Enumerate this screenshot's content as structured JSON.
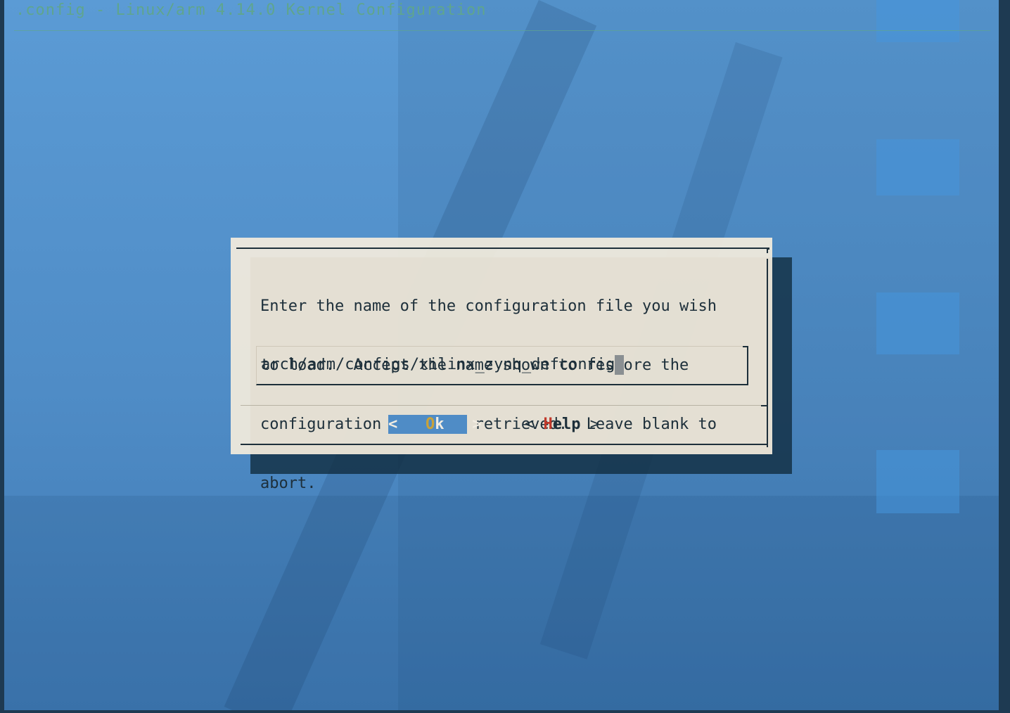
{
  "window": {
    "title": ".config - Linux/arm 4.14.0 Kernel Configuration"
  },
  "dialog": {
    "prompt_lines": [
      "Enter the name of the configuration file you wish",
      "to load.  Accept the name shown to restore the",
      "configuration you last retrieved.  Leave blank to",
      "abort."
    ],
    "input_value": "arch/arm/configs/xilinx_zynq_defconfig",
    "buttons": {
      "ok": {
        "left": "<",
        "hotkey": "O",
        "rest": "k",
        "right": ">"
      },
      "help": {
        "left": "<",
        "hotkey": "H",
        "rest": "elp",
        "right": ">"
      }
    }
  },
  "colors": {
    "background": "#5b9bd5",
    "dialog": "#f3ecdd",
    "title_text": "#5fa58e",
    "selected_button": "#4f8cc6",
    "ok_hotkey": "#c8a23a",
    "help_hotkey": "#c0392b"
  }
}
